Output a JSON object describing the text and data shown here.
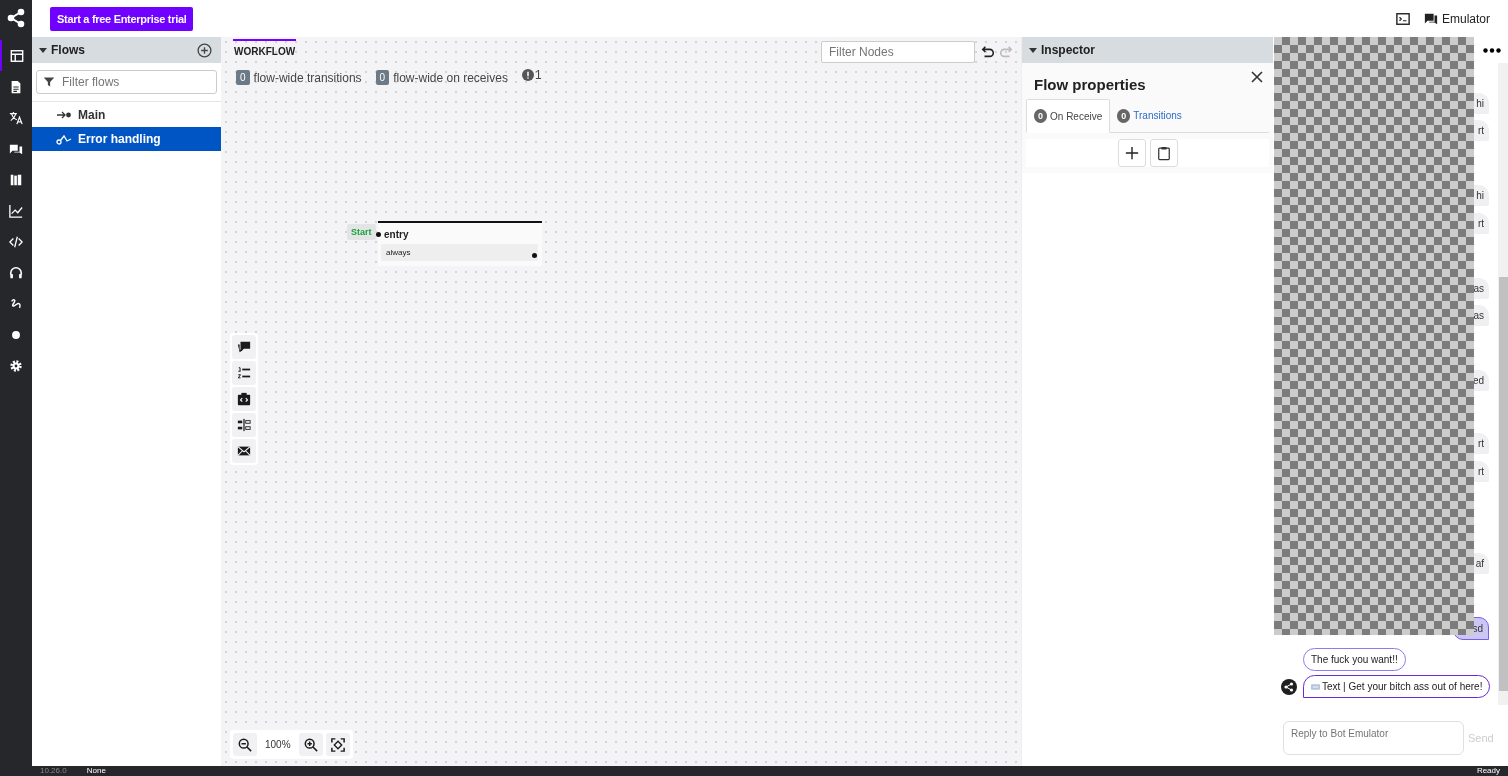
{
  "topbar": {
    "trial_button": "Start a free Enterprise trial",
    "emulator_button": "Emulator"
  },
  "nav": [
    {
      "kind": "flows",
      "selected": true
    },
    {
      "kind": "content",
      "selected": false
    },
    {
      "kind": "translate",
      "selected": false
    },
    {
      "kind": "qna",
      "selected": false
    },
    {
      "kind": "library",
      "selected": false
    },
    {
      "kind": "analytics",
      "selected": false
    },
    {
      "kind": "code",
      "selected": false
    },
    {
      "kind": "hitl",
      "selected": false
    },
    {
      "kind": "nlu",
      "selected": false
    },
    {
      "kind": "dot",
      "selected": false
    },
    {
      "kind": "settings",
      "selected": false
    }
  ],
  "flows_panel": {
    "title": "Flows",
    "filter_placeholder": "Filter flows",
    "items": [
      {
        "label": "Main",
        "kind": "main",
        "selected": false
      },
      {
        "label": "Error handling",
        "kind": "error",
        "selected": true
      }
    ]
  },
  "workflow": {
    "tab": "WORKFLOW",
    "filter_placeholder": "Filter Nodes",
    "redo_disabled": true,
    "counters": [
      {
        "count": "0",
        "label": "flow-wide transitions"
      },
      {
        "count": "0",
        "label": "flow-wide on receives"
      }
    ],
    "warnings": "1",
    "node": {
      "start": "Start",
      "name": "entry",
      "transition": "always"
    },
    "tools": [
      {
        "kind": "say"
      },
      {
        "kind": "list"
      },
      {
        "kind": "code"
      },
      {
        "kind": "split"
      },
      {
        "kind": "mail"
      }
    ],
    "zoom": "100%"
  },
  "inspector": {
    "title": "Inspector",
    "heading": "Flow properties",
    "tabs": [
      {
        "count": "0",
        "label": "On Receive",
        "selected": true
      },
      {
        "count": "0",
        "label": "Transitions",
        "selected": false
      }
    ]
  },
  "emulator": {
    "messages": [
      {
        "text": "hi",
        "selected": false
      },
      {
        "text": "rt",
        "selected": false
      },
      {
        "text": "hi",
        "selected": false
      },
      {
        "text": "rt",
        "selected": false
      },
      {
        "text": "as",
        "selected": false
      },
      {
        "text": "as",
        "selected": false
      },
      {
        "text": "ed",
        "selected": false
      },
      {
        "text": "rt",
        "selected": false
      },
      {
        "text": "rt",
        "selected": false
      },
      {
        "text": "af",
        "selected": false
      },
      {
        "text": "sd",
        "selected": true
      }
    ],
    "bot_messages": [
      {
        "text": "The fuck you want!!",
        "kind": "plain"
      },
      {
        "text": "Text | Get your bitch ass out of here!",
        "kind": "typed"
      }
    ],
    "placeholder": "Reply to Bot Emulator",
    "send": "Send"
  },
  "status_bar": {
    "version": "10.26.0",
    "left": "None",
    "right": "Ready"
  }
}
